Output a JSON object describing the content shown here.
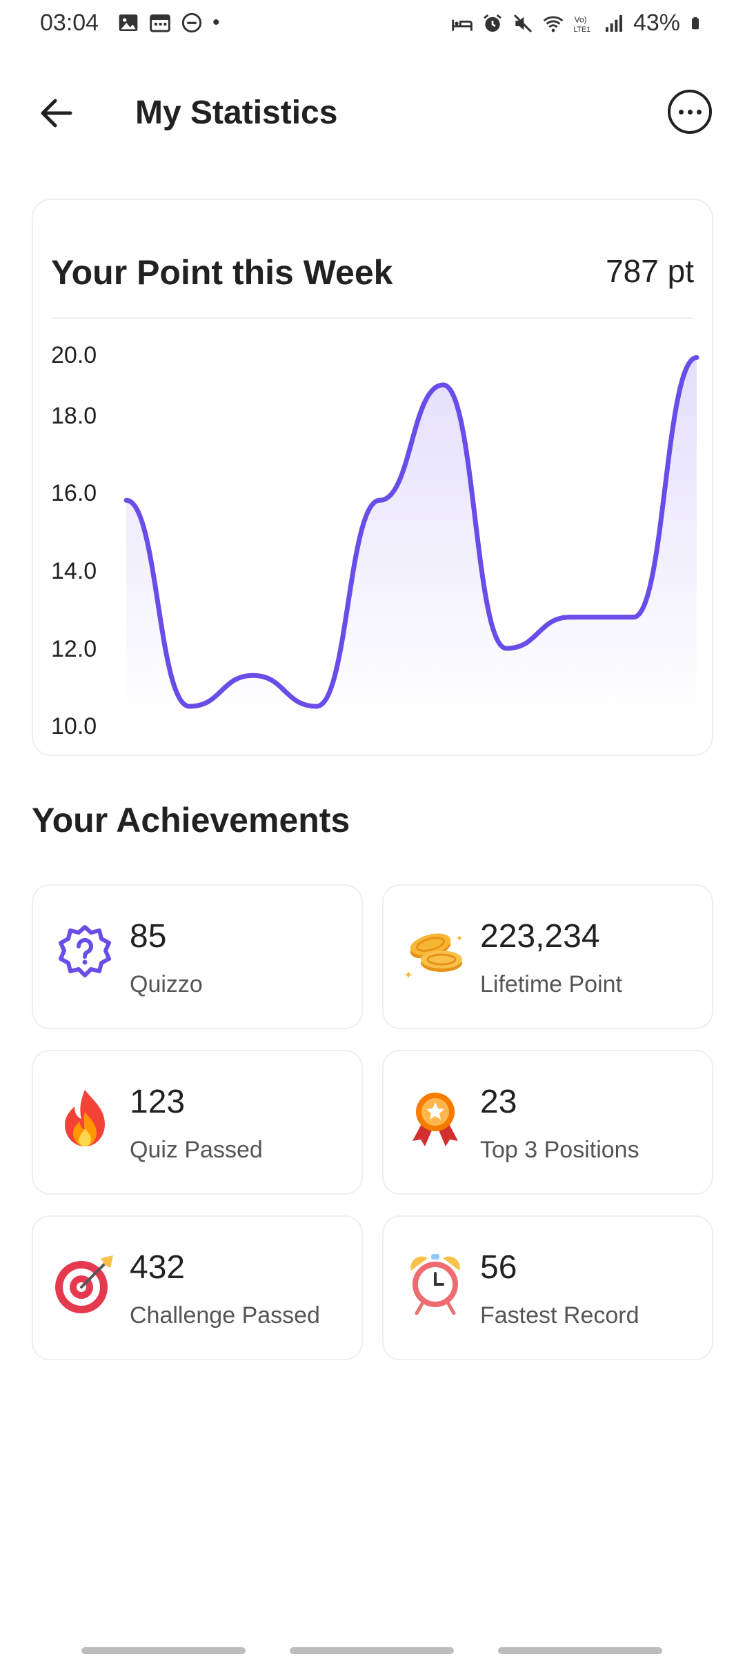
{
  "status": {
    "time": "03:04",
    "dot": "•",
    "battery": "43%",
    "icons": [
      "gallery-icon",
      "calendar-icon",
      "dnd-icon",
      "sleep-icon",
      "alarm-icon",
      "mute-icon",
      "wifi-icon",
      "volte-icon",
      "signal-icon",
      "battery-icon"
    ]
  },
  "header": {
    "title": "My Statistics",
    "back_icon": "arrow-left-icon",
    "more_icon": "more-horizontal-icon"
  },
  "week_card": {
    "title": "Your Point this Week",
    "points": "787 pt"
  },
  "chart_data": {
    "type": "area",
    "title": "Your Point this Week",
    "y_ticks": [
      "20.0",
      "18.0",
      "16.0",
      "14.0",
      "12.0",
      "10.0"
    ],
    "ylim": [
      10,
      20
    ],
    "x": [
      0,
      1,
      2,
      3,
      4,
      5,
      6,
      7,
      8,
      9
    ],
    "values": [
      15.8,
      10.5,
      11.3,
      10.5,
      15.8,
      19.0,
      12.0,
      12.8,
      12.8,
      19.9
    ],
    "grid": false,
    "colors": {
      "line": "#6a4de8",
      "fill_top": "#e4defb",
      "fill_bottom": "#ffffff"
    }
  },
  "achievements": {
    "title": "Your Achievements",
    "items": [
      {
        "value": "85",
        "label": "Quizzo",
        "icon": "quiz-badge-icon"
      },
      {
        "value": "223,234",
        "label": "Lifetime Point",
        "icon": "coins-icon"
      },
      {
        "value": "123",
        "label": "Quiz Passed",
        "icon": "fire-icon"
      },
      {
        "value": "23",
        "label": "Top 3 Positions",
        "icon": "medal-icon"
      },
      {
        "value": "432",
        "label": "Challenge Passed",
        "icon": "target-icon"
      },
      {
        "value": "56",
        "label": "Fastest Record",
        "icon": "alarm-clock-icon"
      }
    ]
  }
}
